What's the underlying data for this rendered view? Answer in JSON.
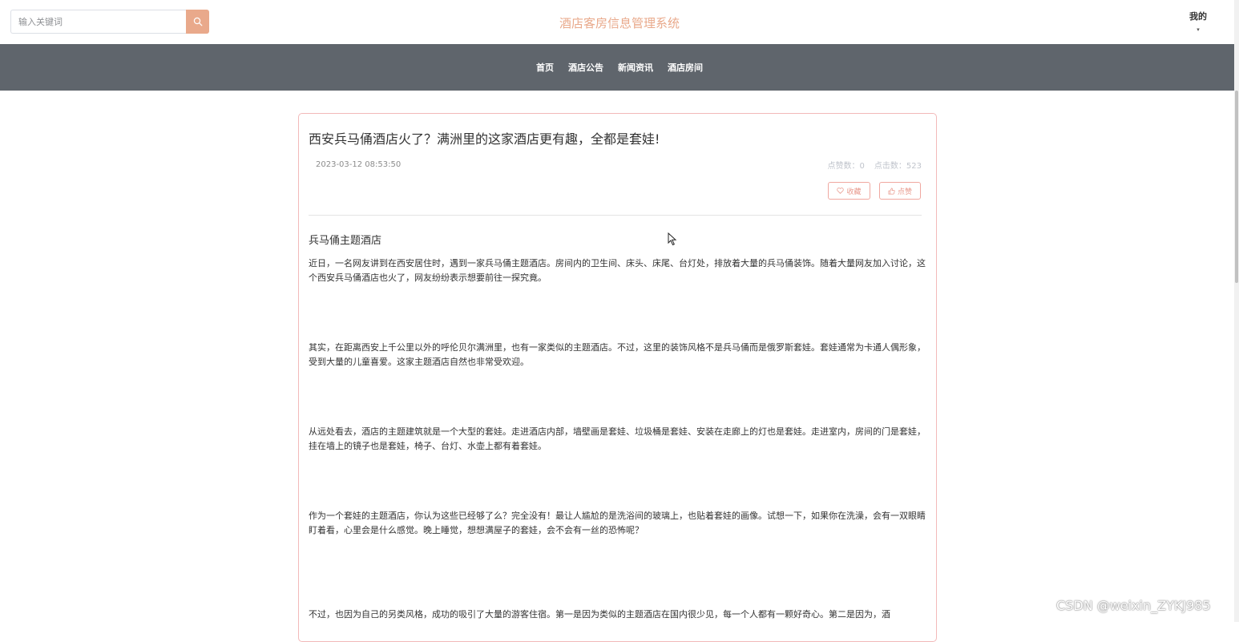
{
  "header": {
    "search_placeholder": "输入关键词",
    "site_title": "酒店客房信息管理系统",
    "user_menu_label": "我的",
    "user_menu_caret": "▾"
  },
  "nav": {
    "items": [
      {
        "label": "首页"
      },
      {
        "label": "酒店公告"
      },
      {
        "label": "新闻资讯"
      },
      {
        "label": "酒店房间"
      }
    ]
  },
  "article": {
    "title": "西安兵马俑酒店火了？满洲里的这家酒店更有趣，全都是套娃!",
    "date": "2023-03-12 08:53:50",
    "likes_label": "点赞数：0",
    "clicks_label": "点击数：523",
    "favorite_label": "收藏",
    "like_label": "点赞",
    "subheading": "兵马俑主题酒店",
    "paragraphs": [
      "近日，一名网友讲到在西安居住时，遇到一家兵马俑主题酒店。房间内的卫生间、床头、床尾、台灯处，排放着大量的兵马俑装饰。随着大量网友加入讨论，这个西安兵马俑酒店也火了，网友纷纷表示想要前往一探究竟。",
      "其实，在距离西安上千公里以外的呼伦贝尔满洲里，也有一家类似的主题酒店。不过，这里的装饰风格不是兵马俑而是俄罗斯套娃。套娃通常为卡通人偶形象，受到大量的儿童喜爱。这家主题酒店自然也非常受欢迎。",
      "从远处看去，酒店的主题建筑就是一个大型的套娃。走进酒店内部，墙壁画是套娃、垃圾桶是套娃、安装在走廊上的灯也是套娃。走进室内，房间的门是套娃，挂在墙上的镜子也是套娃，椅子、台灯、水壶上都有着套娃。",
      "作为一个套娃的主题酒店，你认为这些已经够了么？完全没有！最让人尴尬的是洗浴间的玻璃上，也贴着套娃的画像。试想一下，如果你在洗澡，会有一双眼睛盯着看，心里会是什么感觉。晚上睡觉，想想满屋子的套娃，会不会有一丝的恐怖呢？",
      "不过，也因为自己的另类风格，成功的吸引了大量的游客住宿。第一是因为类似的主题酒店在国内很少见，每一个人都有一颗好奇心。第二是因为，酒"
    ]
  },
  "watermark": "CSDN @weixin_ZYKJ985",
  "colors": {
    "accent": "#e9a98b",
    "nav_bg": "#5f656c",
    "card_border": "#f2b9b9"
  }
}
